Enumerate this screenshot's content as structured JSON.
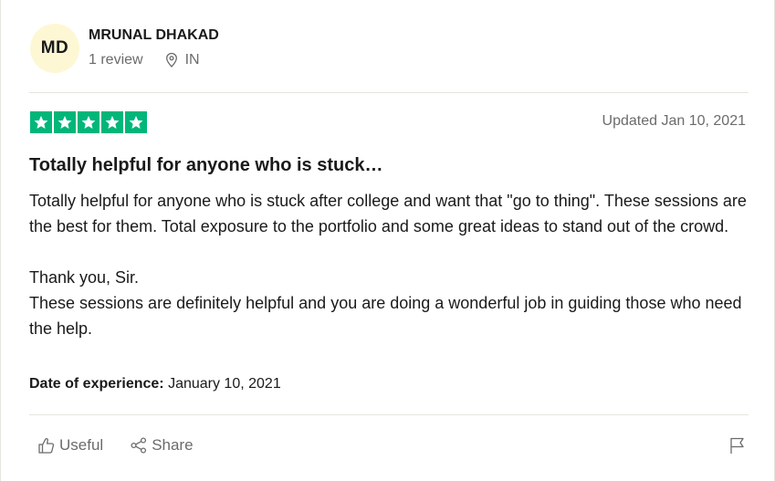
{
  "reviewer": {
    "initials": "MD",
    "name": "MRUNAL DHAKAD",
    "review_count": "1 review",
    "country": "IN"
  },
  "review": {
    "rating": 5,
    "star_color": "#00b67a",
    "updated": "Updated Jan 10, 2021",
    "title": "Totally helpful for anyone who is stuck…",
    "body_line1": "Totally helpful for anyone who is stuck after college and want that \"go to thing\". These sessions are the best for them. Total exposure to the portfolio and some great ideas to stand out of the crowd.",
    "body_line2": "Thank you, Sir.",
    "body_line3": "These sessions are definitely helpful and you are doing a wonderful job in guiding those who need the help.",
    "experience_label": "Date of experience:",
    "experience_date": "January 10, 2021"
  },
  "actions": {
    "useful_label": "Useful",
    "share_label": "Share"
  },
  "icons": {
    "location": "location-pin-icon",
    "useful": "thumbs-up-icon",
    "share": "share-icon",
    "report": "flag-icon"
  }
}
